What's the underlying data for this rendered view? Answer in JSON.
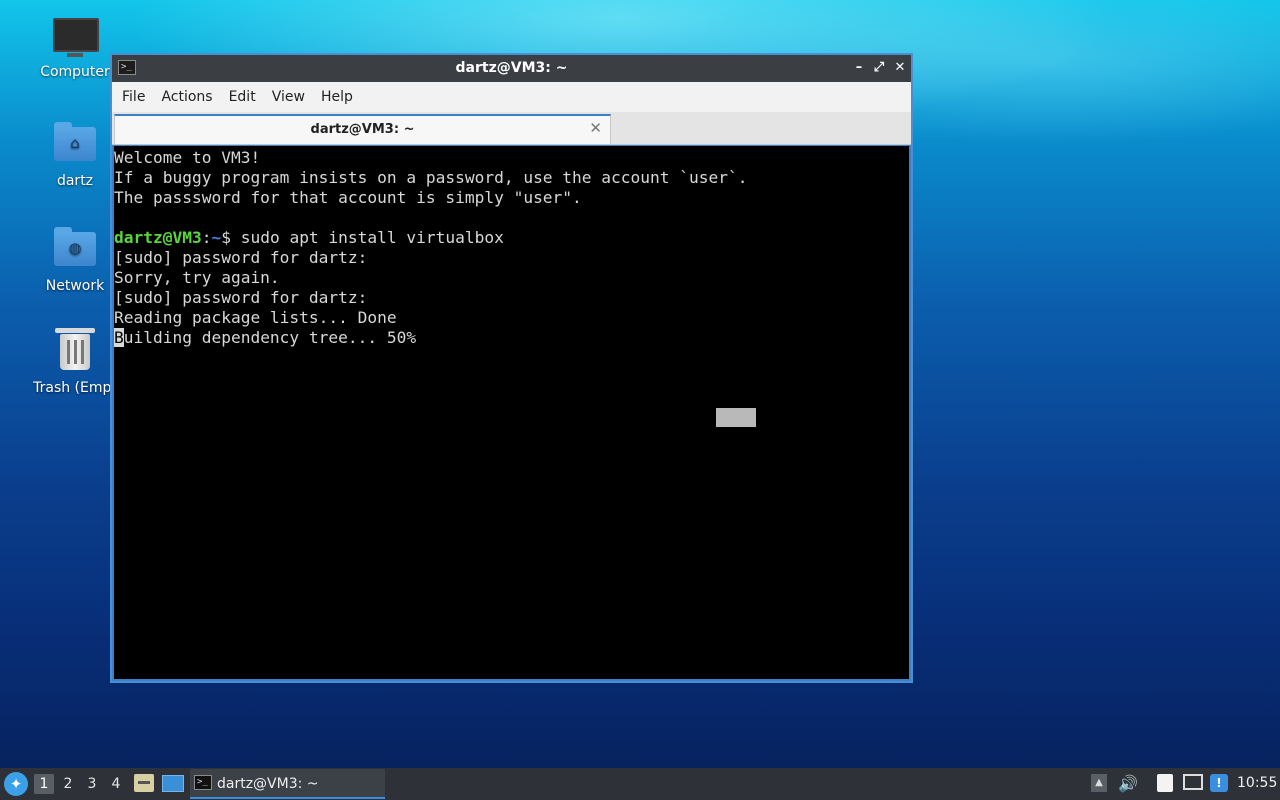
{
  "desktop": {
    "icons": [
      {
        "label": "Computer"
      },
      {
        "label": "dartz"
      },
      {
        "label": "Network"
      },
      {
        "label": "Trash (Empt"
      }
    ]
  },
  "window": {
    "title": "dartz@VM3: ~",
    "controls": {
      "minimize": "–",
      "maximize": "⤢",
      "close": "✕"
    },
    "menu": [
      "File",
      "Actions",
      "Edit",
      "View",
      "Help"
    ],
    "tab": {
      "label": "dartz@VM3: ~",
      "close": "✕"
    }
  },
  "terminal": {
    "lines": [
      "Welcome to VM3!",
      "If a buggy program insists on a password, use the account `user`.",
      "The passsword for that account is simply \"user\".",
      ""
    ],
    "prompt": {
      "user_host": "dartz@VM3",
      "sep": ":",
      "path": "~",
      "symbol": "$",
      "command": " sudo apt install virtualbox"
    },
    "output": [
      "[sudo] password for dartz:",
      "Sorry, try again.",
      "[sudo] password for dartz:",
      "Reading package lists... Done"
    ],
    "last_line": {
      "cursor_char": "B",
      "rest": "uilding dependency tree... 50%"
    }
  },
  "taskbar": {
    "workspaces": [
      "1",
      "2",
      "3",
      "4"
    ],
    "active_workspace": "1",
    "task_label": "dartz@VM3: ~",
    "clock": "10:55",
    "icons": [
      "start-menu-icon",
      "file-manager-icon",
      "show-desktop-icon",
      "terminal-icon",
      "tray-expand-icon",
      "volume-icon",
      "clipboard-icon",
      "network-icon",
      "update-icon"
    ]
  },
  "colors": {
    "accent": "#3a7fc7",
    "prompt_user": "#5ad63c",
    "prompt_path": "#4c7fe0",
    "terminal_bg": "#000000",
    "terminal_fg": "#d8d8d8"
  }
}
